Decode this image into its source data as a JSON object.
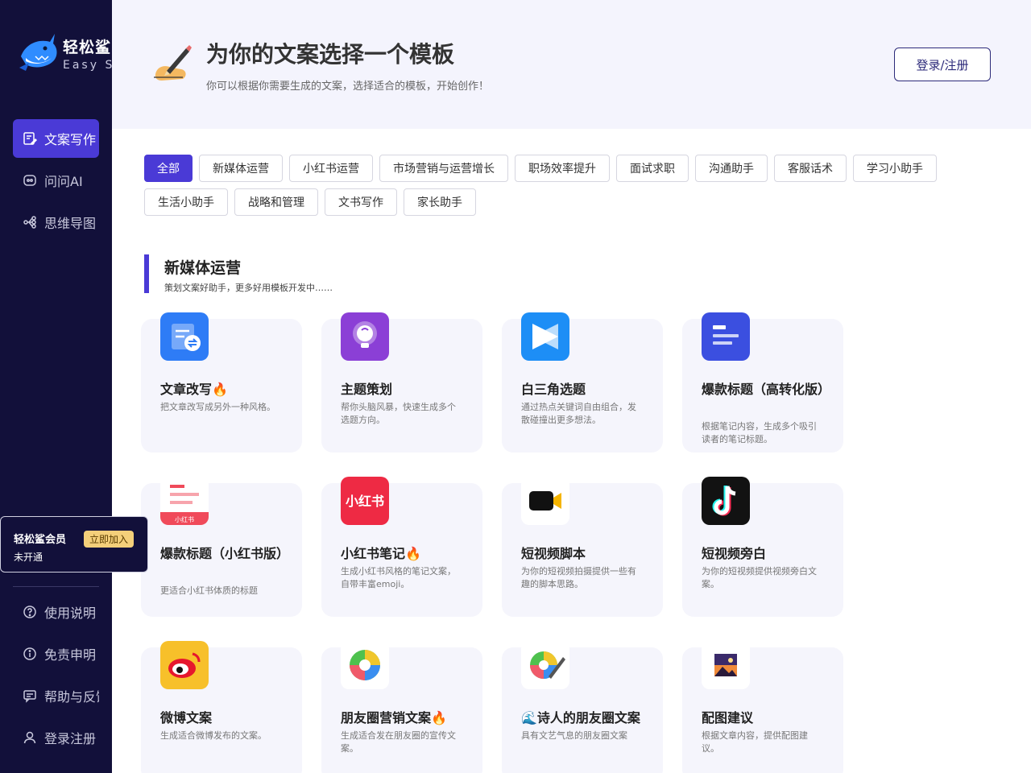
{
  "brand": {
    "name_cn": "轻松鲨",
    "name_en": "Easy Shark"
  },
  "nav": [
    {
      "label": "文案写作",
      "icon": "edit-doc-icon",
      "active": true
    },
    {
      "label": "问问AI",
      "icon": "ai-chat-icon",
      "active": false
    },
    {
      "label": "思维导图",
      "icon": "mindmap-icon",
      "active": false
    }
  ],
  "member": {
    "title": "轻松鲨会员",
    "status": "未开通",
    "join": "立即加入"
  },
  "footer_nav": [
    {
      "label": "使用说明",
      "icon": "help-circle-icon"
    },
    {
      "label": "免责申明",
      "icon": "info-circle-icon"
    },
    {
      "label": "帮助与反馈",
      "icon": "feedback-icon"
    },
    {
      "label": "登录注册",
      "icon": "user-icon"
    }
  ],
  "header": {
    "title": "为你的文案选择一个模板",
    "subtitle": "你可以根据你需要生成的文案，选择适合的模板，开始创作！",
    "login": "登录/注册"
  },
  "categories": [
    "全部",
    "新媒体运营",
    "小红书运营",
    "市场营销与运营增长",
    "职场效率提升",
    "面试求职",
    "沟通助手",
    "客服话术",
    "学习小助手",
    "生活小助手",
    "战略和管理",
    "文书写作",
    "家长助手"
  ],
  "active_category": "全部",
  "section": {
    "title": "新媒体运营",
    "subtitle": "策划文案好助手，更多好用模板开发中……"
  },
  "cards": [
    {
      "title": "文章改写🔥",
      "desc": "把文章改写成另外一种风格。",
      "icon": "article-rewrite-icon"
    },
    {
      "title": "主题策划",
      "desc": "帮你头脑风暴，快速生成多个选题方向。",
      "icon": "lightbulb-icon"
    },
    {
      "title": "白三角选题",
      "desc": "通过热点关键词自由组合，发散碰撞出更多想法。",
      "icon": "triangle-play-icon"
    },
    {
      "title": "爆款标题（高转化版）",
      "desc": "根据笔记内容，生成多个吸引读者的笔记标题。",
      "icon": "headline-icon"
    },
    {
      "title": "爆款标题（小红书版）",
      "desc": "更适合小红书体质的标题",
      "icon": "xiaohongshu-doc-icon"
    },
    {
      "title": "小红书笔记🔥",
      "desc": "生成小红书风格的笔记文案，自带丰富emoji。",
      "icon": "xiaohongshu-icon"
    },
    {
      "title": "短视频脚本",
      "desc": "为你的短视频拍摄提供一些有趣的脚本思路。",
      "icon": "video-camera-icon"
    },
    {
      "title": "短视频旁白",
      "desc": "为你的短视频提供视频旁白文案。",
      "icon": "douyin-icon"
    },
    {
      "title": "微博文案",
      "desc": "生成适合微博发布的文案。",
      "icon": "weibo-icon"
    },
    {
      "title": "朋友圈营销文案🔥",
      "desc": "生成适合发在朋友圈的宣传文案。",
      "icon": "moments-icon"
    },
    {
      "title": "🌊诗人的朋友圈文案",
      "desc": "具有文艺气息的朋友圈文案",
      "icon": "moments-pen-icon"
    },
    {
      "title": "配图建议",
      "desc": "根据文章内容，提供配图建议。",
      "icon": "picture-icon"
    }
  ]
}
